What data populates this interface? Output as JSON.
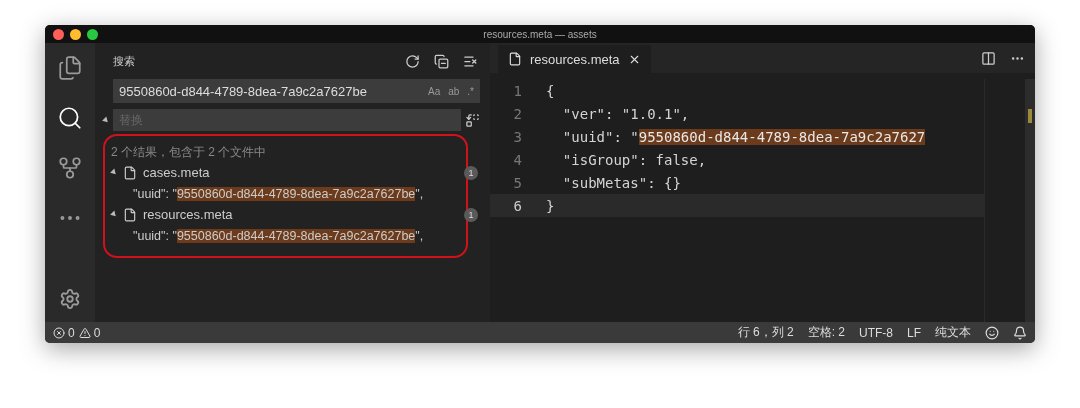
{
  "window": {
    "title": "resources.meta — assets"
  },
  "activity_bar": [
    {
      "kind": "files",
      "selected": false
    },
    {
      "kind": "search",
      "selected": true
    },
    {
      "kind": "git",
      "selected": false
    },
    {
      "kind": "more",
      "selected": false
    }
  ],
  "sidebar": {
    "title": "搜索",
    "search": {
      "value": "9550860d-d844-4789-8dea-7a9c2a7627be",
      "options": [
        "Aa",
        "ab",
        ".*"
      ]
    },
    "replace": {
      "placeholder": "替换",
      "expanded": true
    },
    "summary": "2 个结果，包含于 2 个文件中",
    "results": [
      {
        "file": "cases.meta",
        "count": "1",
        "expanded": true,
        "matches": [
          {
            "before": "\"uuid\": \"",
            "match": "9550860d-d844-4789-8dea-7a9c2a7627be",
            "after": "\","
          }
        ]
      },
      {
        "file": "resources.meta",
        "count": "1",
        "expanded": true,
        "matches": [
          {
            "before": "\"uuid\": \"",
            "match": "9550860d-d844-4789-8dea-7a9c2a7627be",
            "after": "\","
          }
        ]
      }
    ]
  },
  "editor": {
    "tabs": [
      {
        "label": "resources.meta",
        "selected": true
      }
    ],
    "lines": [
      {
        "number": "1",
        "text": "{",
        "current": false
      },
      {
        "number": "2",
        "text": "  \"ver\": \"1.0.1\",",
        "current": false
      },
      {
        "number": "3",
        "text": "  \"uuid\": \"",
        "match": "9550860d-d844-4789-8dea-7a9c2a7627",
        "current": false
      },
      {
        "number": "4",
        "text": "  \"isGroup\": false,",
        "current": false
      },
      {
        "number": "5",
        "text": "  \"subMetas\": {}",
        "current": false
      },
      {
        "number": "6",
        "text": "}",
        "current": true
      }
    ]
  },
  "status_bar": {
    "errors": "0",
    "warnings": "0",
    "items": [
      "行 6，列 2",
      "空格: 2",
      "UTF-8",
      "LF",
      "纯文本"
    ]
  }
}
